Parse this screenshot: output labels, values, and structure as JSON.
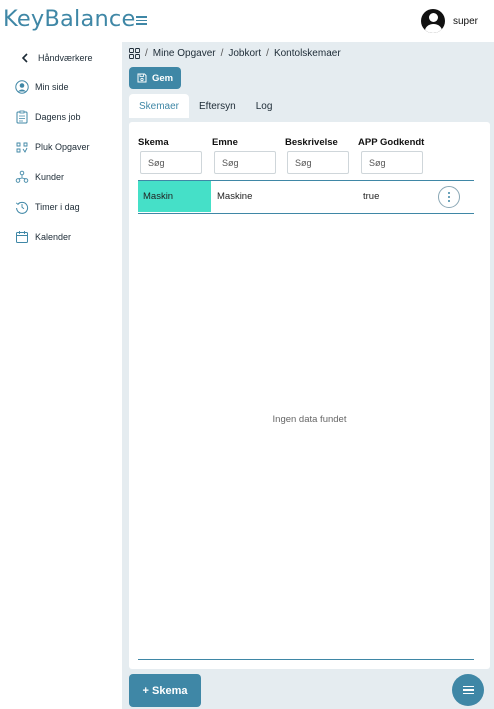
{
  "app": {
    "logo_text": "KeyBalance",
    "brand_color": "#3f87a6",
    "highlight_color": "#45e0c8"
  },
  "header": {
    "user_name": "super",
    "menu_icon": "hamburger-icon",
    "user_icon": "user-avatar-icon"
  },
  "sidebar": {
    "back_label": "Håndværkere",
    "items": [
      {
        "label": "Min side",
        "icon": "user-circle-icon"
      },
      {
        "label": "Dagens job",
        "icon": "clipboard-icon"
      },
      {
        "label": "Pluk Opgaver",
        "icon": "pick-tasks-icon"
      },
      {
        "label": "Kunder",
        "icon": "customers-network-icon"
      },
      {
        "label": "Timer i dag",
        "icon": "clock-history-icon"
      },
      {
        "label": "Kalender",
        "icon": "calendar-icon"
      }
    ]
  },
  "breadcrumb": {
    "items": [
      "Mine Opgaver",
      "Jobkort",
      "Kontolskemaer"
    ],
    "separator": "/"
  },
  "toolbar": {
    "save_label": "Gem"
  },
  "tabs": [
    {
      "label": "Skemaer",
      "active": true
    },
    {
      "label": "Eftersyn",
      "active": false
    },
    {
      "label": "Log",
      "active": false
    }
  ],
  "table": {
    "columns": [
      "Skema",
      "Emne",
      "Beskrivelse",
      "APP Godkendt"
    ],
    "search_placeholder": "Søg",
    "rows": [
      {
        "skema": "Maskin",
        "emne": "Maskine",
        "beskrivelse": "",
        "app_godkendt": "true"
      }
    ],
    "empty_text": "Ingen data fundet"
  },
  "footer": {
    "add_label": "+ Skema"
  }
}
